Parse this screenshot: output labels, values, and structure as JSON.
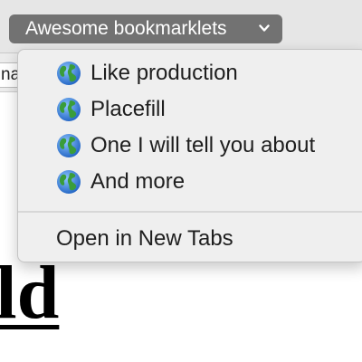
{
  "bookmarks_bar": {
    "folder_label": "Awesome bookmarklets",
    "folder_icon": "chevron-down-icon",
    "tab_fragment": "na"
  },
  "menu": {
    "items": [
      {
        "label": "Like production",
        "icon": "globe-icon"
      },
      {
        "label": "Placefill",
        "icon": "globe-icon"
      },
      {
        "label": "One I will tell you about",
        "icon": "globe-icon"
      },
      {
        "label": "And more",
        "icon": "globe-icon"
      }
    ],
    "open_all_label": "Open in New Tabs"
  },
  "page": {
    "heading_fragment": "eld"
  },
  "colors": {
    "folder_button_bg": "#727272",
    "menu_bg": "#efefef",
    "globe_ocean": "#2f7fd6",
    "globe_land": "#3a9d3a"
  }
}
